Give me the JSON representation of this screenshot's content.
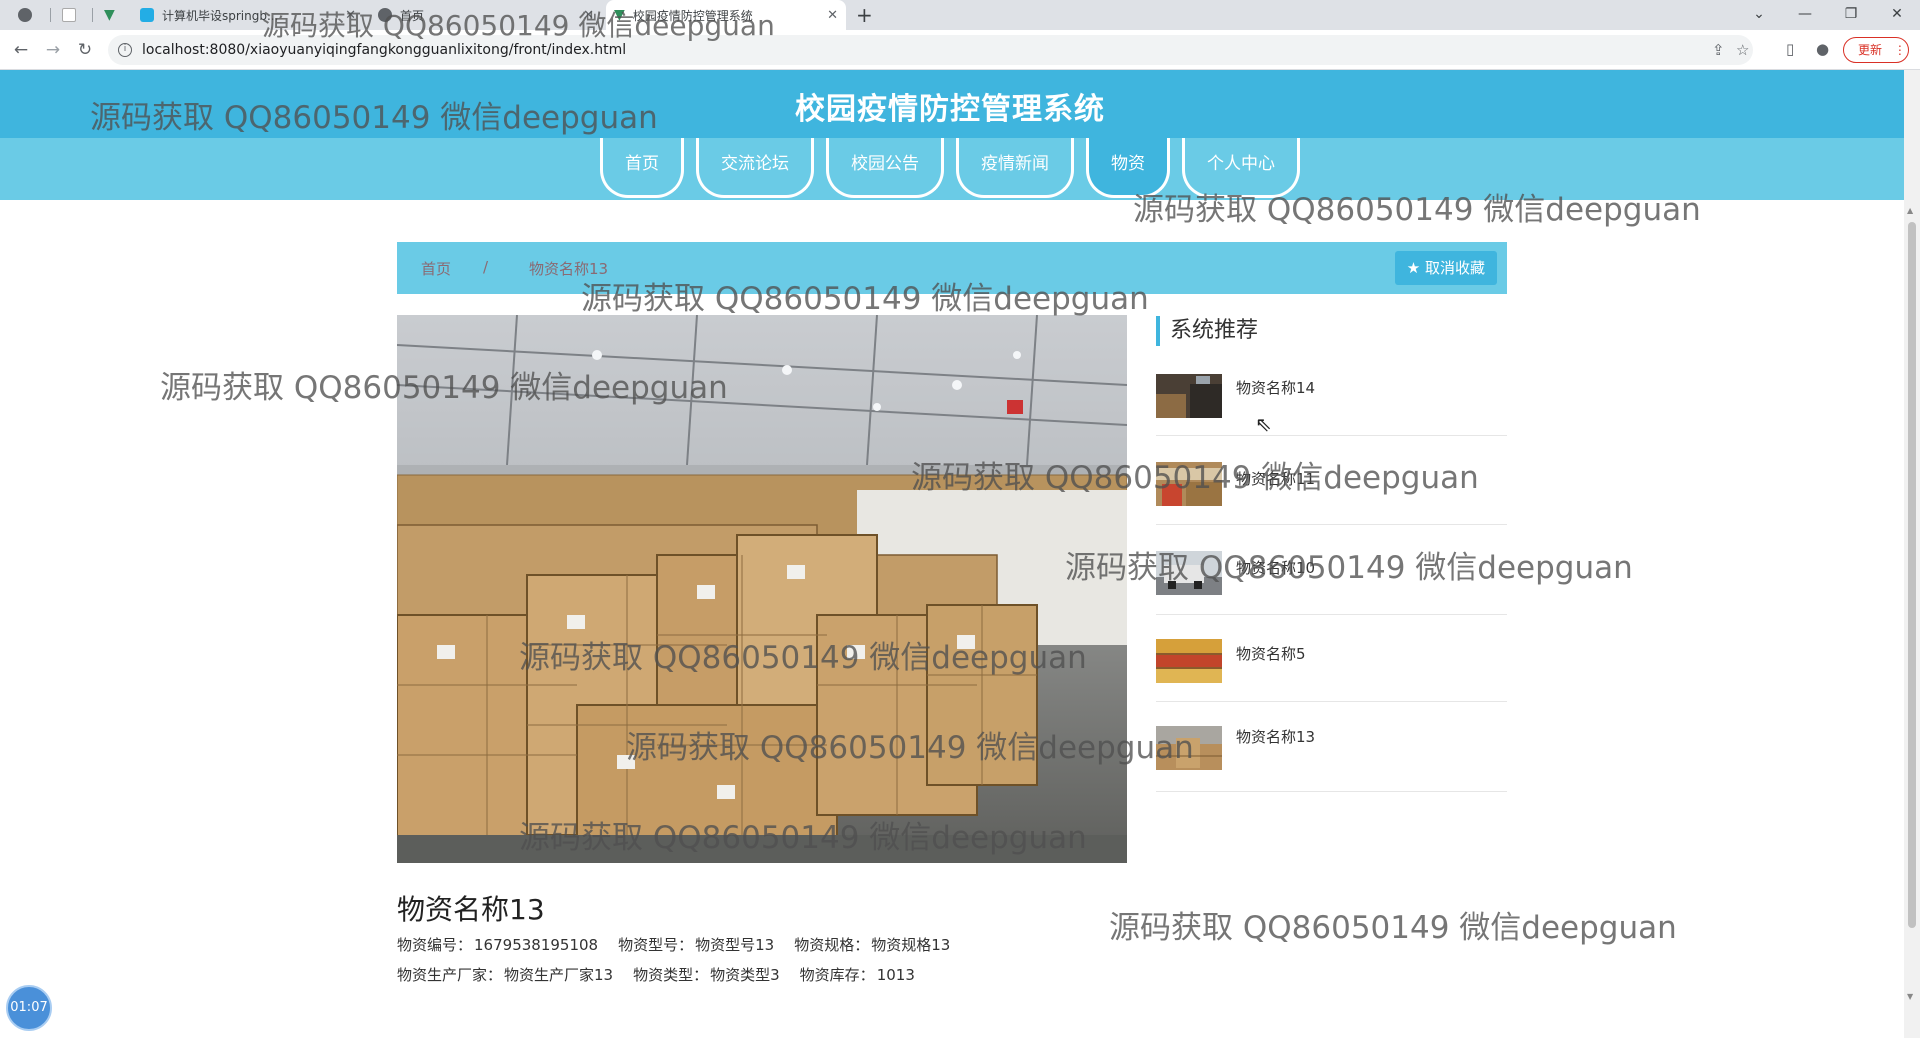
{
  "browser": {
    "tabs": [
      {
        "title": "",
        "favicon": "generic-icon"
      },
      {
        "title": "",
        "favicon": "blank-page-icon"
      },
      {
        "title": "",
        "favicon": "vue-icon"
      },
      {
        "title": "计算机毕设springb...",
        "favicon": "bilibili-icon"
      },
      {
        "title": "首页",
        "favicon": "globe-icon"
      },
      {
        "title": "校园疫情防控管理系统",
        "favicon": "vue-icon"
      }
    ],
    "url": "localhost:8080/xiaoyuanyiqingfangkongguanlixitong/front/index.html",
    "update_label": "更新"
  },
  "site": {
    "title": "校园疫情防控管理系统",
    "nav": [
      "首页",
      "交流论坛",
      "校园公告",
      "疫情新闻",
      "物资",
      "个人中心"
    ],
    "active_nav": "物资"
  },
  "breadcrumb": {
    "home": "首页",
    "separator": "/",
    "current": "物资名称13",
    "fav_button": "取消收藏"
  },
  "recommend": {
    "title": "系统推荐",
    "items": [
      "物资名称14",
      "物资名称11",
      "物资名称10",
      "物资名称5",
      "物资名称13"
    ]
  },
  "product": {
    "title": "物资名称13",
    "fields": [
      {
        "label": "物资编号：",
        "value": "1679538195108"
      },
      {
        "label": "物资型号：",
        "value": "物资型号13"
      },
      {
        "label": "物资规格：",
        "value": "物资规格13"
      },
      {
        "label": "物资生产厂家：",
        "value": "物资生产厂家13"
      },
      {
        "label": "物资类型：",
        "value": "物资类型3"
      },
      {
        "label": "物资库存：",
        "value": "1013"
      }
    ]
  },
  "timer": "01:07",
  "watermark": "源码获取 QQ86050149 微信deepguan",
  "colors": {
    "header": "#3fb5de",
    "nav_band": "#6acbe6",
    "accent": "#3fb5de"
  }
}
